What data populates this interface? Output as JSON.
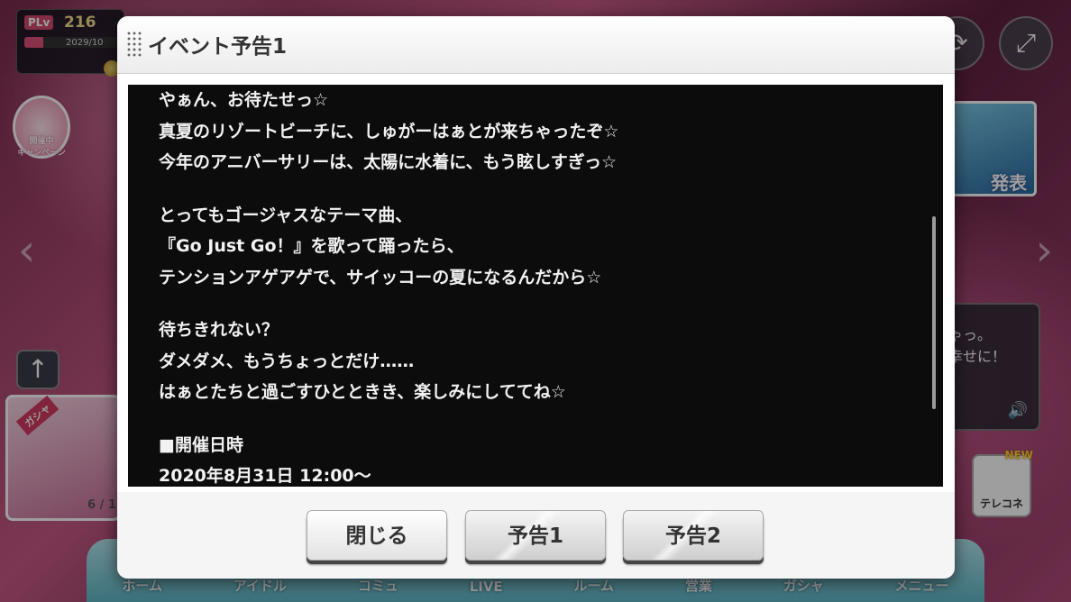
{
  "background": {
    "player_level": {
      "tag": "PLv",
      "value": "216",
      "date_fragment": "2029/10",
      "exp_fraction": 0.2
    },
    "campaign_label": "開催中\nキャンペーン",
    "gacha": {
      "tag": "ガシャ",
      "count": "6 / 1"
    },
    "right_banner_text": "発表",
    "chat_text": "ゃっ。\n幸せに！",
    "tereconne": {
      "label": "テレコネ",
      "badge": "NEW"
    },
    "nav": [
      "ホーム",
      "アイドル",
      "コミュ",
      "LIVE",
      "ルーム",
      "営業",
      "ガシャ",
      "メニュー"
    ]
  },
  "modal": {
    "title": "イベント予告1",
    "body": [
      [
        "やぁん、お待たせっ☆",
        "真夏のリゾートビーチに、しゅがーはぁとが来ちゃったぞ☆",
        "今年のアニバーサリーは、太陽に水着に、もう眩しすぎっ☆"
      ],
      [
        "とってもゴージャスなテーマ曲、",
        "『Go Just Go！』を歌って踊ったら、",
        "テンションアゲアゲで、サイッコーの夏になるんだから☆"
      ],
      [
        "待ちきれない？",
        "ダメダメ、もうちょっとだけ……",
        "はぁとたちと過ごすひとときき、楽しみにしててね☆"
      ],
      [
        "■開催日時",
        "2020年8月31日 12:00〜"
      ]
    ],
    "buttons": {
      "close": "閉じる",
      "notice1": "予告1",
      "notice2": "予告2"
    }
  }
}
